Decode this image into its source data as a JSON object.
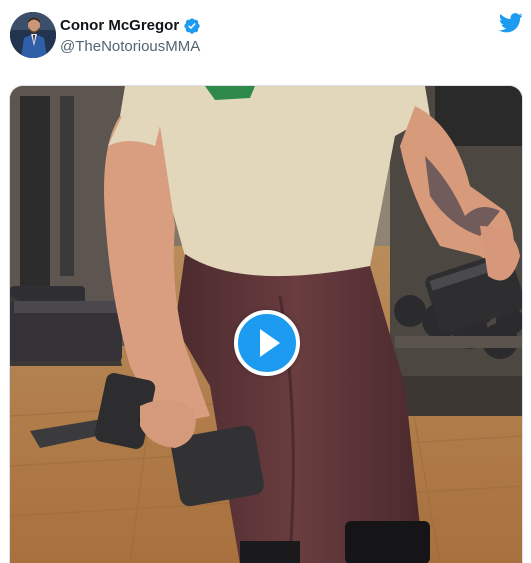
{
  "tweet": {
    "author": {
      "display_name": "Conor McGregor",
      "handle": "@TheNotoriousMMA",
      "verified": true
    },
    "icons": {
      "verified": "verified-badge-icon",
      "platform": "twitter-bird-icon",
      "play": "play-icon"
    },
    "media": {
      "type": "video"
    }
  },
  "colors": {
    "accent": "#1d9bf0",
    "name_text": "#0f1419",
    "handle_text": "#536471"
  }
}
